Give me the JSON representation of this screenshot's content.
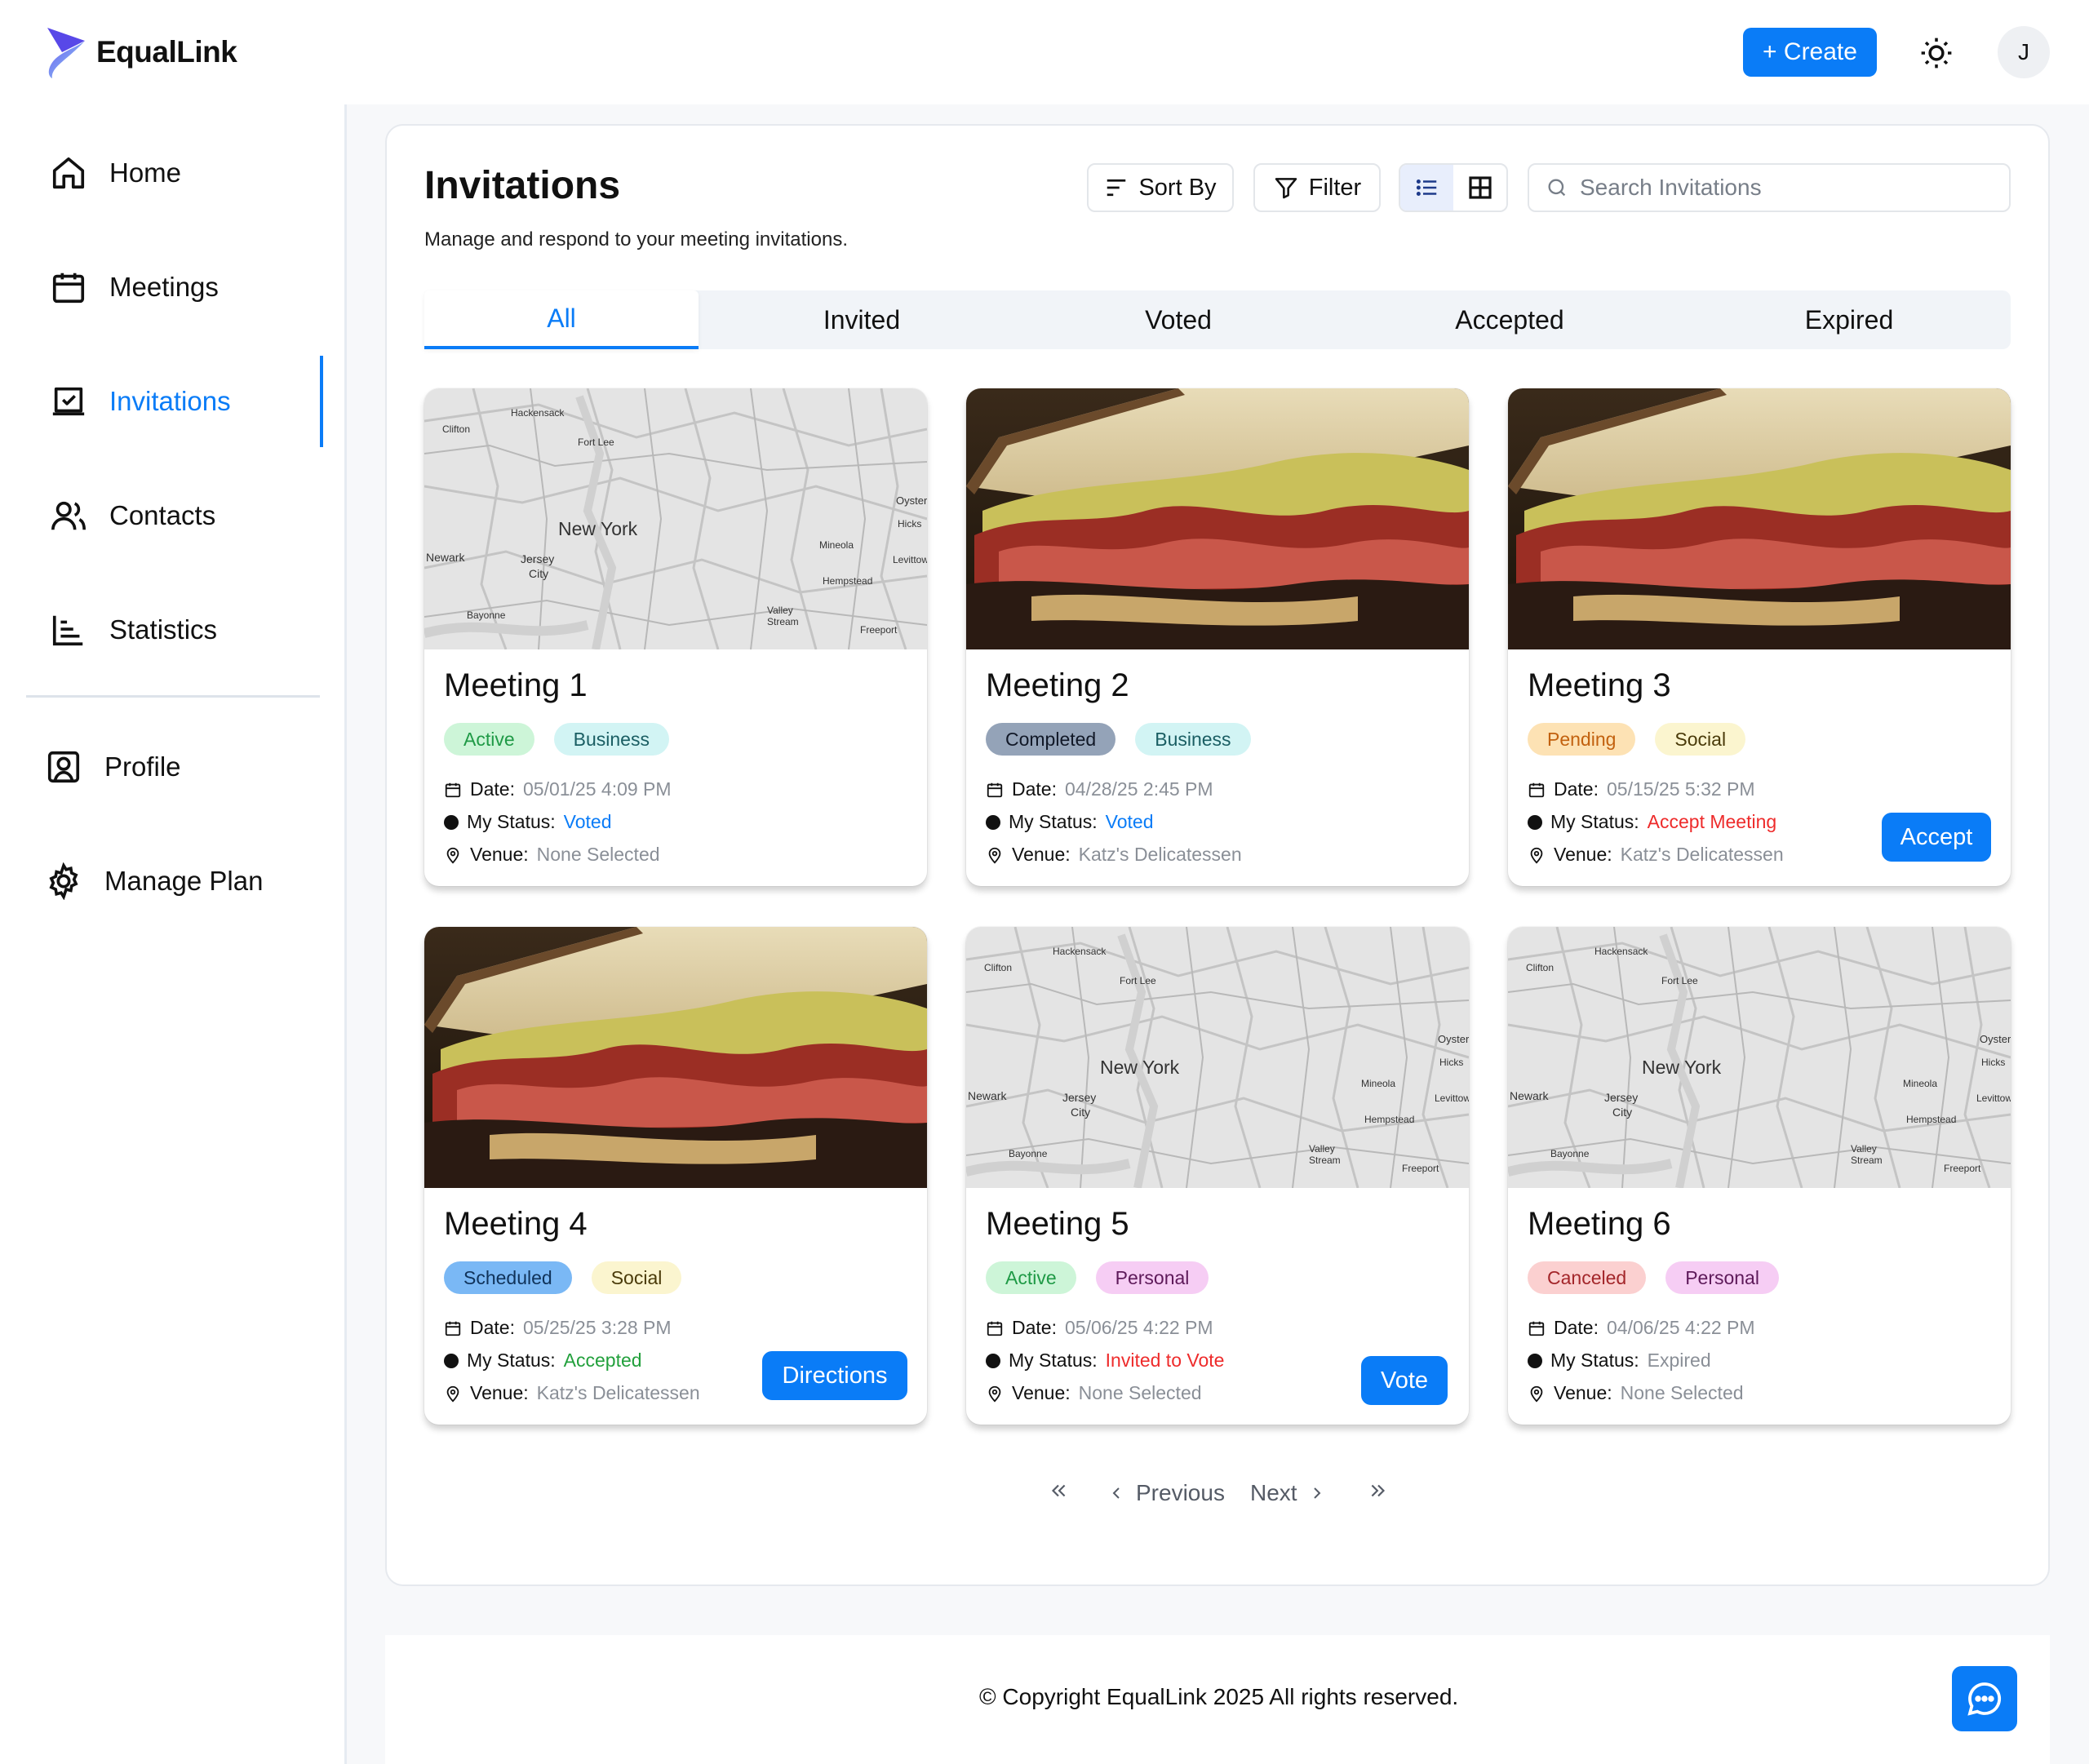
{
  "app": {
    "name": "EqualLink"
  },
  "header": {
    "create_label": "+ Create",
    "avatar_initial": "J"
  },
  "sidebar": {
    "items": [
      {
        "label": "Home",
        "icon": "home-icon"
      },
      {
        "label": "Meetings",
        "icon": "calendar-icon"
      },
      {
        "label": "Invitations",
        "icon": "invitation-icon",
        "active": true
      },
      {
        "label": "Contacts",
        "icon": "contacts-icon"
      },
      {
        "label": "Statistics",
        "icon": "chart-icon"
      }
    ],
    "secondary": [
      {
        "label": "Profile",
        "icon": "profile-icon"
      },
      {
        "label": "Manage Plan",
        "icon": "gear-icon"
      }
    ]
  },
  "page": {
    "title": "Invitations",
    "subtitle": "Manage and respond to your meeting invitations.",
    "sort_label": "Sort By",
    "filter_label": "Filter",
    "search_placeholder": "Search Invitations"
  },
  "tabs": [
    "All",
    "Invited",
    "Voted",
    "Accepted",
    "Expired"
  ],
  "labels": {
    "date": "Date:",
    "status": "My Status:",
    "venue": "Venue:"
  },
  "map_labels": [
    "New York",
    "Jersey City",
    "Newark",
    "Hackensack",
    "Fort Lee",
    "Clifton",
    "Bayonne",
    "Mineola",
    "Hempstead",
    "Valley Stream",
    "Freeport",
    "Oyster",
    "Hicks",
    "Levittow"
  ],
  "cards": [
    {
      "title": "Meeting 1",
      "image": "map",
      "badges": [
        {
          "text": "Active",
          "bg": "#cdf5d8",
          "fg": "#1f9a46"
        },
        {
          "text": "Business",
          "bg": "#d2f4f4",
          "fg": "#1a5e63"
        }
      ],
      "date": "05/01/25 4:09 PM",
      "status": "Voted",
      "status_color": "#0a7cf7",
      "venue": "None Selected",
      "button": ""
    },
    {
      "title": "Meeting 2",
      "image": "sandwich",
      "badges": [
        {
          "text": "Completed",
          "bg": "#94a3b8",
          "fg": "#111827"
        },
        {
          "text": "Business",
          "bg": "#d2f4f4",
          "fg": "#1a5e63"
        }
      ],
      "date": "04/28/25 2:45 PM",
      "status": "Voted",
      "status_color": "#0a7cf7",
      "venue": "Katz's Delicatessen",
      "button": ""
    },
    {
      "title": "Meeting 3",
      "image": "sandwich",
      "badges": [
        {
          "text": "Pending",
          "bg": "#fde2b4",
          "fg": "#c2610f"
        },
        {
          "text": "Social",
          "bg": "#fbf5cf",
          "fg": "#4a3b0a"
        }
      ],
      "date": "05/15/25 5:32 PM",
      "status": "Accept Meeting",
      "status_color": "#ee2b2b",
      "venue": "Katz's Delicatessen",
      "button": "Accept"
    },
    {
      "title": "Meeting 4",
      "image": "sandwich",
      "badges": [
        {
          "text": "Scheduled",
          "bg": "#7ab8f5",
          "fg": "#10335a"
        },
        {
          "text": "Social",
          "bg": "#fbf5cf",
          "fg": "#4a3b0a"
        }
      ],
      "date": "05/25/25 3:28 PM",
      "status": "Accepted",
      "status_color": "#22a03c",
      "venue": "Katz's Delicatessen",
      "button": "Directions"
    },
    {
      "title": "Meeting 5",
      "image": "map",
      "badges": [
        {
          "text": "Active",
          "bg": "#cdf5d8",
          "fg": "#1f9a46"
        },
        {
          "text": "Personal",
          "bg": "#f6cdf4",
          "fg": "#5e1a5a"
        }
      ],
      "date": "05/06/25 4:22 PM",
      "status": "Invited to Vote",
      "status_color": "#ee2b2b",
      "venue": "None Selected",
      "button": "Vote"
    },
    {
      "title": "Meeting 6",
      "image": "map",
      "badges": [
        {
          "text": "Canceled",
          "bg": "#fbd0d0",
          "fg": "#a3262a"
        },
        {
          "text": "Personal",
          "bg": "#f6cdf4",
          "fg": "#5e1a5a"
        }
      ],
      "date": "04/06/25 4:22 PM",
      "status": "Expired",
      "status_color": "#8a8f97",
      "venue": "None Selected",
      "button": ""
    }
  ],
  "pagination": {
    "previous": "Previous",
    "next": "Next"
  },
  "footer": {
    "copyright": "© Copyright EqualLink 2025 All rights reserved."
  },
  "colors": {
    "accent": "#0a7cf7"
  }
}
